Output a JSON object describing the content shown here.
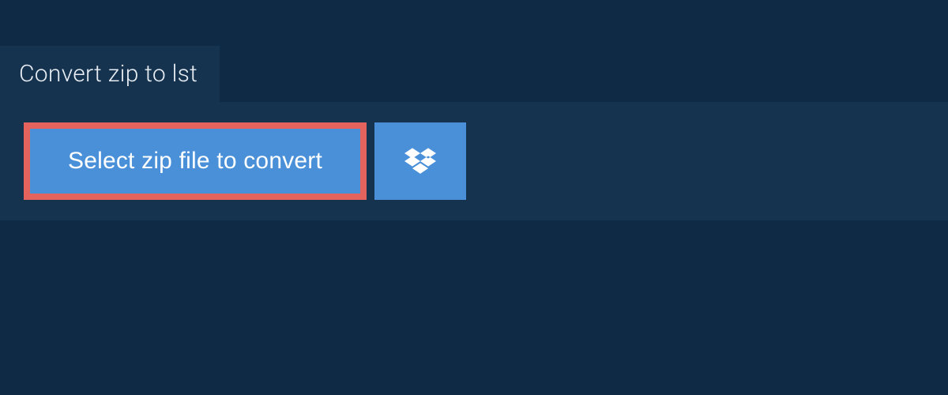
{
  "tab": {
    "title": "Convert zip to lst"
  },
  "actions": {
    "select_label": "Select zip file to convert"
  },
  "colors": {
    "background": "#0f2a44",
    "panel": "#15334f",
    "button": "#4a90d9",
    "highlight_border": "#e4645d",
    "text": "#e8eef4"
  }
}
